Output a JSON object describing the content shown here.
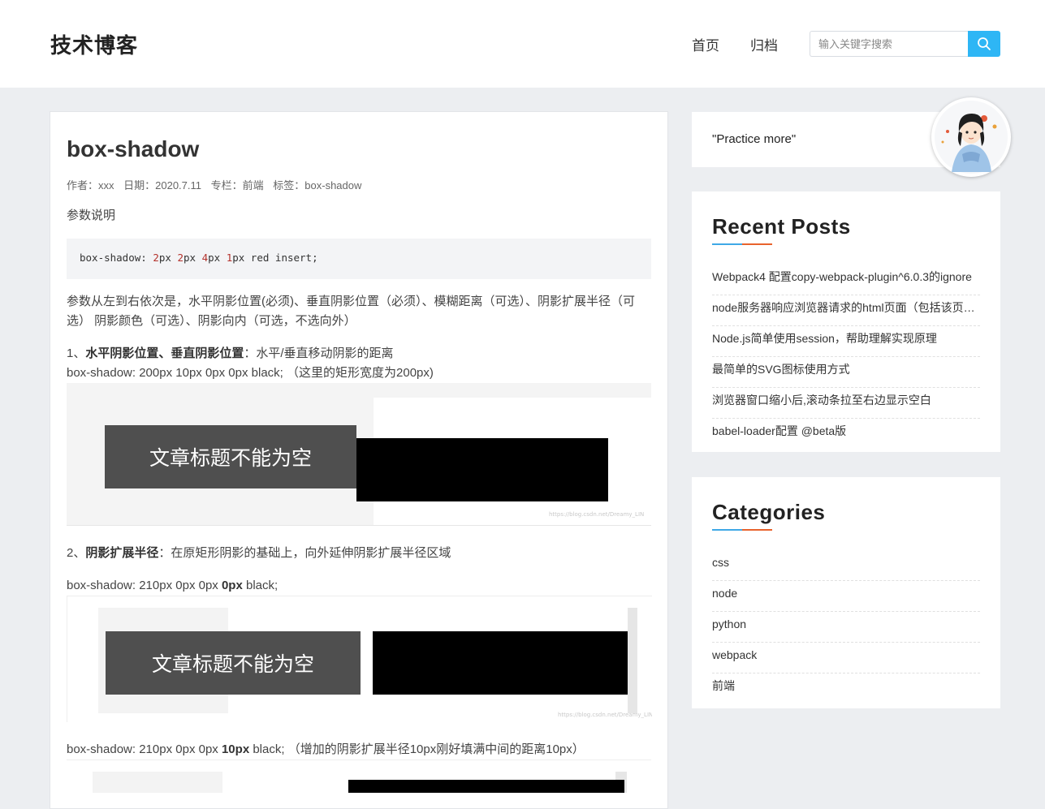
{
  "header": {
    "site_title": "技术博客",
    "nav": [
      {
        "label": "首页"
      },
      {
        "label": "归档"
      }
    ],
    "search_placeholder": "输入关键字搜索"
  },
  "article": {
    "title": "box-shadow",
    "meta": {
      "author": "作者：xxx",
      "date": "日期：2020.7.11",
      "column": "专栏：前端",
      "tags": "标签：box-shadow"
    },
    "intro": "参数说明",
    "code": {
      "prop": "box-shadow:",
      "v1": "2",
      "u1": "px",
      "v2": "2",
      "u2": "px",
      "v3": "4",
      "u3": "px",
      "v4": "1",
      "u4": "px red insert;"
    },
    "params_desc": "参数从左到右依次是，水平阴影位置(必须)、垂直阴影位置（必须）、模糊距离（可选）、阴影扩展半径（可选） 阴影颜色（可选）、阴影向内（可选，不选向外）",
    "section1": {
      "prefix": "1、",
      "bold": "水平阴影位置、垂直阴影位置",
      "rest": "：水平/垂直移动阴影的距离",
      "example": "box-shadow: 200px 10px 0px 0px black; （这里的矩形宽度为200px)"
    },
    "section2": {
      "prefix": "2、",
      "bold": "阴影扩展半径",
      "rest": "：在原矩形阴影的基础上，向外延伸阴影扩展半径区域",
      "example_a_pre": "box-shadow: 210px 0px 0px ",
      "example_a_bold": "0px",
      "example_a_post": " black;",
      "example_b_pre": "box-shadow: 210px 0px 0px ",
      "example_b_bold": "10px",
      "example_b_post": " black; （增加的阴影扩展半径10px刚好填满中间的距离10px）"
    },
    "demo_text": "文章标题不能为空",
    "watermark": "https://blog.csdn.net/Dreamy_LIN"
  },
  "sidebar": {
    "motto": "\"Practice more\"",
    "recent_posts": {
      "heading": "Recent Posts",
      "items": [
        {
          "label": "Webpack4 配置copy-webpack-plugin^6.0.3的ignore"
        },
        {
          "label": "node服务器响应浏览器请求的html页面（包括该页面..."
        },
        {
          "label": "Node.js简单使用session，帮助理解实现原理"
        },
        {
          "label": "最简单的SVG图标使用方式"
        },
        {
          "label": "浏览器窗口缩小后,滚动条拉至右边显示空白"
        },
        {
          "label": "babel-loader配置 @beta版"
        }
      ]
    },
    "categories": {
      "heading": "Categories",
      "items": [
        {
          "label": "css"
        },
        {
          "label": "node"
        },
        {
          "label": "python"
        },
        {
          "label": "webpack"
        },
        {
          "label": "前端"
        }
      ]
    }
  },
  "colors": {
    "accent": "#2eb6f5",
    "underline_blue": "#3fa8e6",
    "underline_orange": "#e8632d",
    "page_bg": "#eceef1"
  }
}
